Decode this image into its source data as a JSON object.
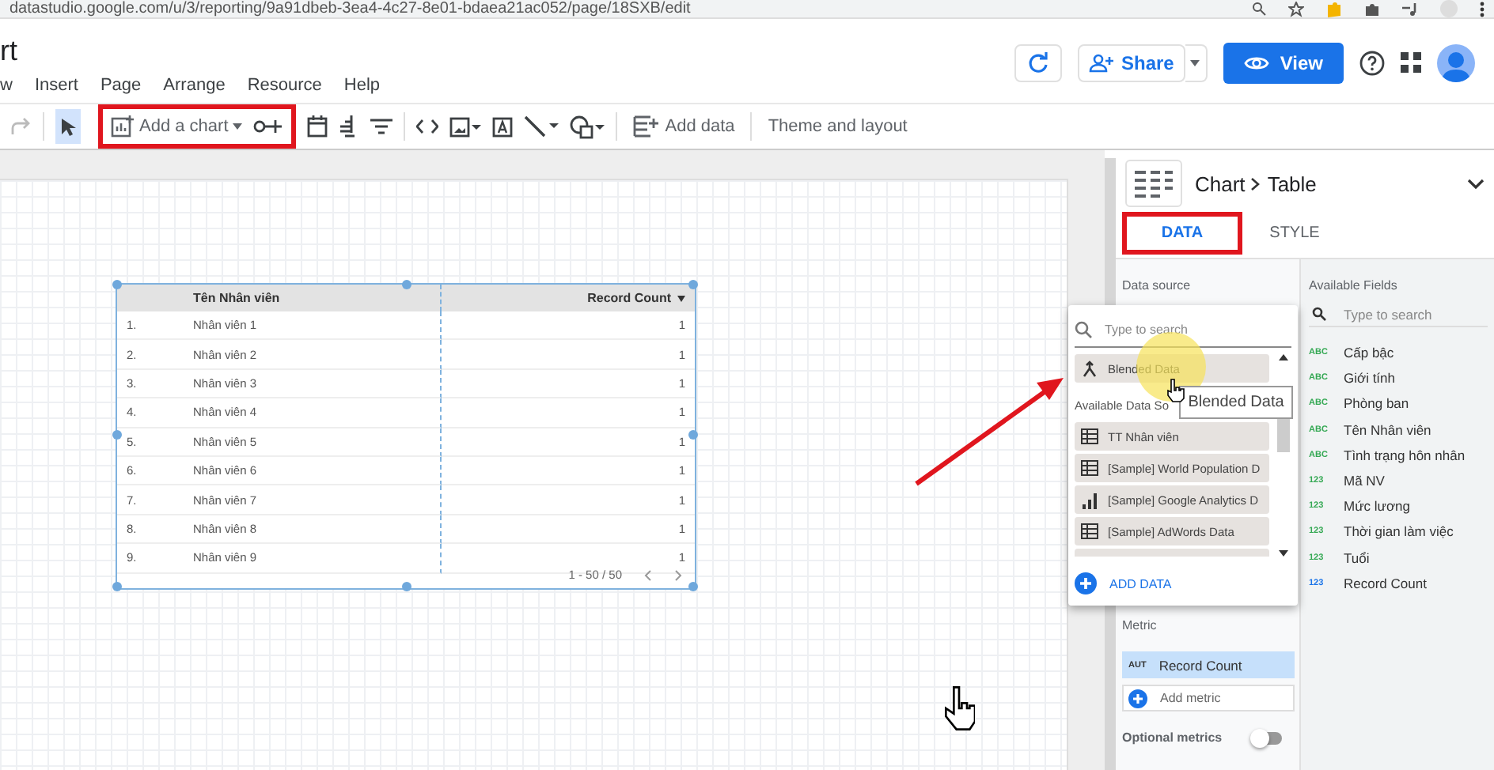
{
  "browser": {
    "url": "datastudio.google.com/u/3/reporting/9a91dbeb-3ea4-4c27-8e01-bdaea21ac052/page/18SXB/edit"
  },
  "report": {
    "title": "rt"
  },
  "menu": [
    "w",
    "Insert",
    "Page",
    "Arrange",
    "Resource",
    "Help"
  ],
  "header": {
    "share": "Share",
    "view": "View"
  },
  "toolbar": {
    "add_chart": "Add a chart",
    "add_data": "Add data",
    "theme": "Theme and layout"
  },
  "table": {
    "columns": [
      "Tên Nhân viên",
      "Record Count"
    ],
    "pagination": "1 - 50 / 50",
    "rows": [
      {
        "index": "1.",
        "name": "Nhân viên 1",
        "count": "1"
      },
      {
        "index": "2.",
        "name": "Nhân viên 2",
        "count": "1"
      },
      {
        "index": "3.",
        "name": "Nhân viên 3",
        "count": "1"
      },
      {
        "index": "4.",
        "name": "Nhân viên 4",
        "count": "1"
      },
      {
        "index": "5.",
        "name": "Nhân viên 5",
        "count": "1"
      },
      {
        "index": "6.",
        "name": "Nhân viên 6",
        "count": "1"
      },
      {
        "index": "7.",
        "name": "Nhân viên 7",
        "count": "1"
      },
      {
        "index": "8.",
        "name": "Nhân viên 8",
        "count": "1"
      },
      {
        "index": "9.",
        "name": "Nhân viên 9",
        "count": "1"
      }
    ]
  },
  "panel": {
    "breadcrumb": [
      "Chart",
      "Table"
    ],
    "tabs": [
      {
        "label": "DATA",
        "selected": true
      },
      {
        "label": "STYLE",
        "selected": false
      }
    ],
    "data_source_label": "Data source",
    "metric_label": "Metric",
    "metric_type": "AUT",
    "metric": "Record Count",
    "add_metric": "Add metric",
    "optional_metrics": {
      "label": "Optional metrics",
      "on": false
    }
  },
  "fields": {
    "title": "Available Fields",
    "placeholder": "Type to search",
    "items": [
      {
        "type": "ABC",
        "name": "Cấp bậc",
        "color": "#34a853"
      },
      {
        "type": "ABC",
        "name": "Giới tính",
        "color": "#34a853"
      },
      {
        "type": "ABC",
        "name": "Phòng ban",
        "color": "#34a853"
      },
      {
        "type": "ABC",
        "name": "Tên Nhân viên",
        "color": "#34a853"
      },
      {
        "type": "ABC",
        "name": "Tình trạng hôn nhân",
        "color": "#34a853"
      },
      {
        "type": "123",
        "name": "Mã NV",
        "color": "#34a853"
      },
      {
        "type": "123",
        "name": "Mức lương",
        "color": "#34a853"
      },
      {
        "type": "123",
        "name": "Thời gian làm việc",
        "color": "#34a853"
      },
      {
        "type": "123",
        "name": "Tuổi",
        "color": "#34a853"
      },
      {
        "type": "123",
        "name": "Record Count",
        "color": "#1a73e8"
      }
    ]
  },
  "source_picker": {
    "placeholder": "Type to search",
    "section": "Available Data So",
    "add": "ADD DATA",
    "items": [
      {
        "name": "Blended Data",
        "kind": "blend"
      },
      {
        "name": "TT Nhân viên",
        "kind": "table"
      },
      {
        "name": "[Sample] World Population D",
        "kind": "table"
      },
      {
        "name": "[Sample] Google Analytics D",
        "kind": "analytics"
      },
      {
        "name": "[Sample] AdWords Data",
        "kind": "table"
      }
    ]
  },
  "tooltip": "Blended Data"
}
